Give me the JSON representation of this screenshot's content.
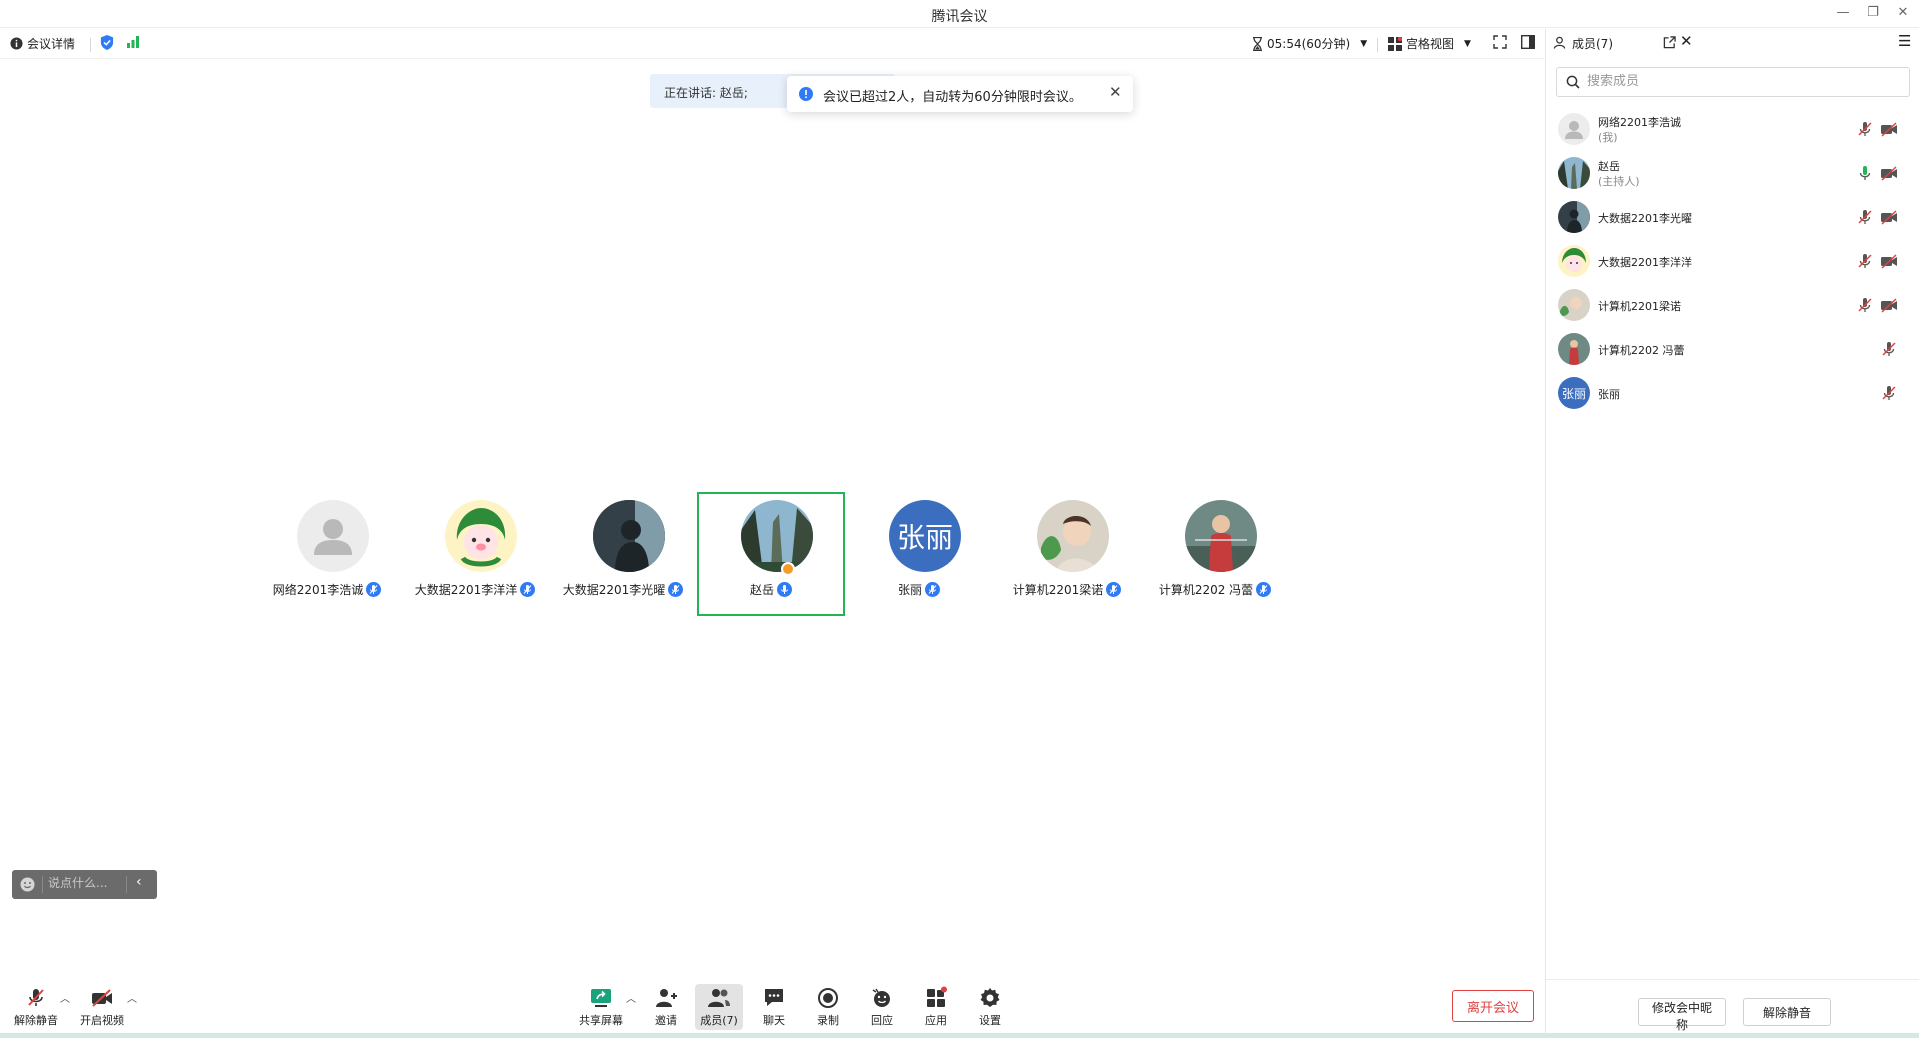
{
  "window": {
    "title": "腾讯会议"
  },
  "topbar": {
    "details_label": "会议详情",
    "timer": "05:54(60分钟)",
    "view_label": "宫格视图"
  },
  "speaking": {
    "label": "正在讲话: 赵岳;"
  },
  "toast": {
    "message": "会议已超过2人，自动转为60分钟限时会议。"
  },
  "tiles": [
    {
      "name": "网络2201李浩诚"
    },
    {
      "name": "大数据2201李洋洋"
    },
    {
      "name": "大数据2201李光曜"
    },
    {
      "name": "赵岳"
    },
    {
      "name": "张丽",
      "avatar_text": "张丽"
    },
    {
      "name": "计算机2201梁诺"
    },
    {
      "name": "计算机2202 冯蕾"
    }
  ],
  "chat": {
    "placeholder": "说点什么..."
  },
  "toolbar": {
    "unmute": "解除静音",
    "video": "开启视频",
    "share": "共享屏幕",
    "invite": "邀请",
    "members": "成员(7)",
    "chat": "聊天",
    "record": "录制",
    "react": "回应",
    "apps": "应用",
    "settings": "设置",
    "leave": "离开会议"
  },
  "panel": {
    "title": "成员(7)",
    "search_placeholder": "搜索成员",
    "members": [
      {
        "name": "网络2201李浩诚",
        "sub": "(我)"
      },
      {
        "name": "赵岳",
        "sub": "(主持人)"
      },
      {
        "name": "大数据2201李光曜",
        "sub": ""
      },
      {
        "name": "大数据2201李洋洋",
        "sub": ""
      },
      {
        "name": "计算机2201梁诺",
        "sub": ""
      },
      {
        "name": "计算机2202 冯蕾",
        "sub": ""
      },
      {
        "name": "张丽",
        "sub": "",
        "avatar_text": "张丽"
      }
    ],
    "rename_button": "修改会中昵称",
    "unmute_all_button": "解除静音"
  },
  "colors": {
    "accent": "#2f7bf5",
    "active_border": "#22b455",
    "leave": "#e04141"
  }
}
